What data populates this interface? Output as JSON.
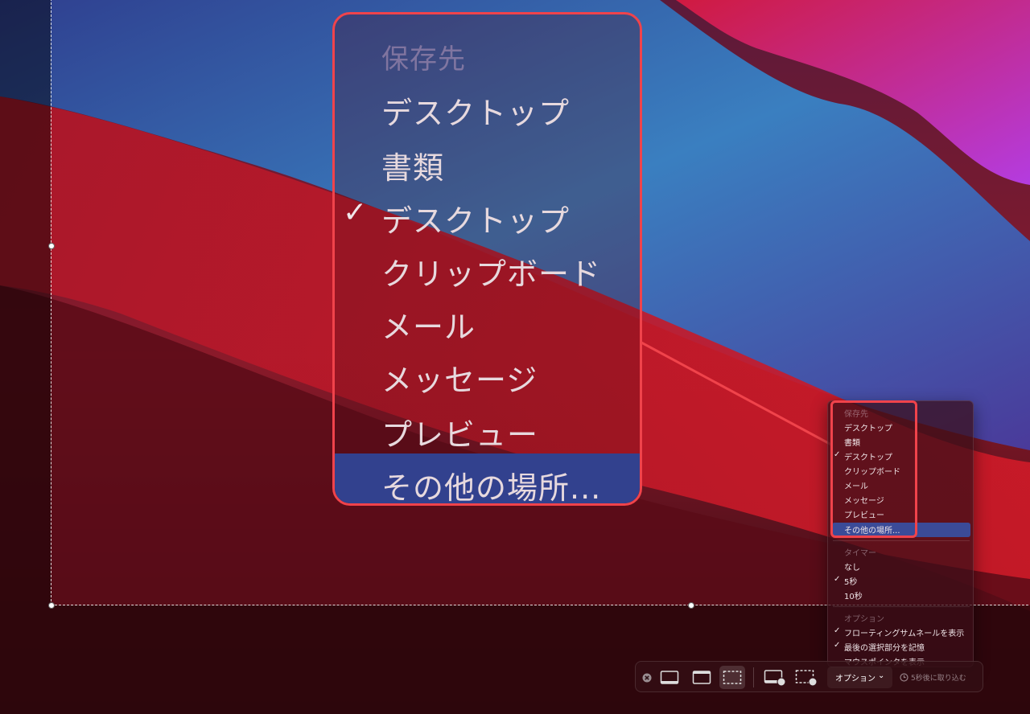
{
  "zoom_callout": {
    "header": "保存先",
    "items": [
      {
        "label": "デスクトップ",
        "checked": false
      },
      {
        "label": "書類",
        "checked": false
      },
      {
        "label": "デスクトップ",
        "checked": true
      },
      {
        "label": "クリップボード",
        "checked": false
      },
      {
        "label": "メール",
        "checked": false
      },
      {
        "label": "メッセージ",
        "checked": false
      },
      {
        "label": "プレビュー",
        "checked": false
      },
      {
        "label": "その他の場所...",
        "checked": false,
        "highlighted": true
      }
    ],
    "check_glyph": "✓"
  },
  "menu": {
    "save_section": {
      "header": "保存先",
      "items": [
        "デスクトップ",
        "書類",
        "デスクトップ",
        "クリップボード",
        "メール",
        "メッセージ",
        "プレビュー",
        "その他の場所..."
      ],
      "checked_index": 2,
      "highlighted_index": 7
    },
    "timer_section": {
      "header": "タイマー",
      "items": [
        "なし",
        "5秒",
        "10秒"
      ],
      "checked_index": 1
    },
    "options_section": {
      "header": "オプション",
      "items": [
        "フローティングサムネールを表示",
        "最後の選択部分を記憶",
        "マウスポインタを表示"
      ],
      "checked": [
        true,
        true,
        false
      ]
    },
    "check_glyph": "✓"
  },
  "toolbar": {
    "options_label": "オプション",
    "options_chevron": "⌄",
    "capture_label": "5秒後に取り込む",
    "icons": [
      "close-icon",
      "capture-entire-screen-icon",
      "capture-window-icon",
      "capture-selection-icon",
      "record-entire-screen-icon",
      "record-selection-icon",
      "timer-icon"
    ]
  },
  "colors": {
    "highlight_frame": "#f0434b",
    "menu_selection": "#3b4b98"
  }
}
